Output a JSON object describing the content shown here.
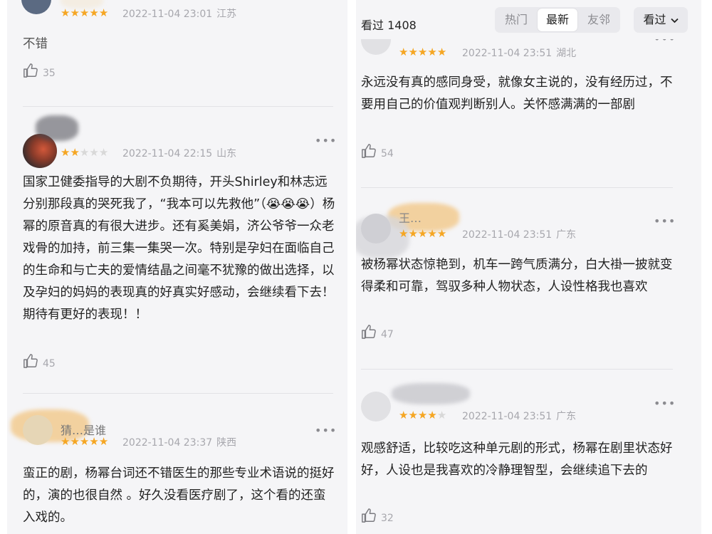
{
  "header": {
    "seen_text": "看过 1408",
    "tabs": [
      {
        "label": "热门",
        "active": false
      },
      {
        "label": "最新",
        "active": true
      },
      {
        "label": "友邻",
        "active": false
      }
    ],
    "filter_label": "看过",
    "filter_icon": "chevron-down-icon"
  },
  "left_reviews": [
    {
      "username": "",
      "stars": 5,
      "date": "2022-11-04 23:01",
      "region": "江苏",
      "text": "不错",
      "likes": "35"
    },
    {
      "username": "",
      "stars": 2,
      "date": "2022-11-04 22:15",
      "region": "山东",
      "text": "国家卫健委指导的大剧不负期待，开头Shirley和林志远分别那段真的哭死我了，“我本可以先救他”（😭😭😭）杨幂的原音真的有很大进步。还有奚美娟，济公爷爷一众老戏骨的加持，前三集一集哭一次。特别是孕妇在面临自己的生命和与亡夫的爱情结晶之间毫不犹豫的做出选择，以及孕妇的妈妈的表现真的好真实好感动，会继续看下去！期待有更好的表现！！",
      "likes": "45"
    },
    {
      "username": "猜…是谁",
      "stars": 5,
      "date": "2022-11-04 23:37",
      "region": "陕西",
      "text": "蛮正的剧，杨幂台词还不错医生的那些专业术语说的挺好的，演的也很自然 。好久没看医疗剧了，这个看的还蛮入戏的。",
      "likes": ""
    }
  ],
  "right_reviews": [
    {
      "username": "",
      "stars": 5,
      "date": "2022-11-04 23:51",
      "region": "湖北",
      "text": "永远没有真的感同身受，就像女主说的，没有经历过，不要用自己的价值观判断别人。关怀感满满的一部剧",
      "likes": "54"
    },
    {
      "username": "王…",
      "stars": 5,
      "date": "2022-11-04 23:51",
      "region": "广东",
      "text": "被杨幂状态惊艳到，机车一跨气质满分，白大褂一披就变得柔和可靠，驾驭多种人物状态，人设性格我也喜欢",
      "likes": "47"
    },
    {
      "username": "",
      "stars": 4,
      "date": "2022-11-04 23:51",
      "region": "广东",
      "text": "观感舒适，比较吃这种单元剧的形式，杨幂在剧里状态好好，人设也是我喜欢的冷静理智型，会继续追下去的",
      "likes": "32"
    }
  ],
  "icons": {
    "like": "thumbs-up-icon",
    "more": "more-dots-icon",
    "star": "star-icon"
  },
  "colors": {
    "star_on": "#f5a623",
    "star_off": "#d8d8d8",
    "meta_gray": "#a7a7ad",
    "background": "#f5f5f7"
  }
}
